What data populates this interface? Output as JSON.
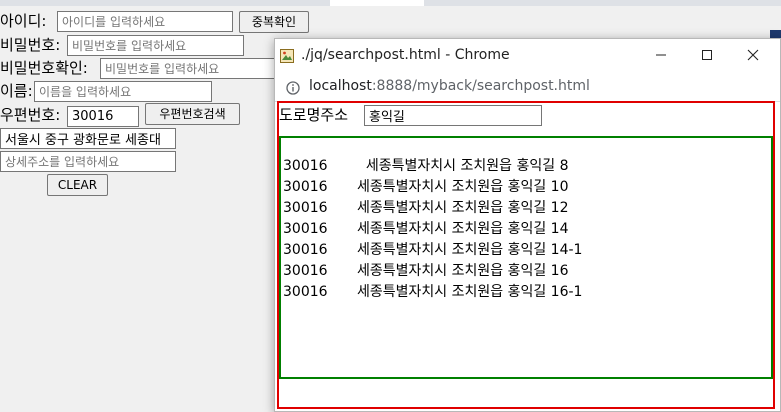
{
  "form": {
    "id_label": "아이디:",
    "id_placeholder": "아이디를 입력하세요",
    "dup_check_button": "중복확인",
    "pw_label": "비밀번호:",
    "pw_placeholder": "비밀번호를 입력하세요",
    "pw_confirm_label": "비밀번호확인:",
    "pw_confirm_placeholder": "비밀번호를 입력하세요",
    "name_label": "이름:",
    "name_placeholder": "이름을 입력하세요",
    "zip_label": "우편번호:",
    "zip_value": "30016",
    "zip_search_button": "우편번호검색",
    "address_value": "서울시 중구 광화문로 세종대",
    "detail_placeholder": "상세주소를 입력하세요",
    "clear_button": "CLEAR"
  },
  "popup": {
    "title": "./jq/searchpost.html - Chrome",
    "url_host": "localhost",
    "url_rest": ":8888/myback/searchpost.html",
    "road_label": "도로명주소",
    "road_value": "홍익길",
    "results": [
      {
        "zip": "30016",
        "address": "  세종특별자치시 조치원읍 홍익길 8"
      },
      {
        "zip": "30016",
        "address": "세종특별자치시 조치원읍 홍익길 10"
      },
      {
        "zip": "30016",
        "address": "세종특별자치시 조치원읍 홍익길 12"
      },
      {
        "zip": "30016",
        "address": "세종특별자치시 조치원읍 홍익길 14"
      },
      {
        "zip": "30016",
        "address": "세종특별자치시 조치원읍 홍익길 14-1"
      },
      {
        "zip": "30016",
        "address": "세종특별자치시 조치원읍 홍익길 16"
      },
      {
        "zip": "30016",
        "address": "세종특별자치시 조치원읍 홍익길 16-1"
      }
    ]
  },
  "icons": {
    "page": "page-icon",
    "info": "info-icon",
    "minimize": "minimize-icon",
    "maximize": "maximize-icon",
    "close": "close-icon"
  },
  "colors": {
    "result_border": "#e00000",
    "list_border": "#008000"
  }
}
